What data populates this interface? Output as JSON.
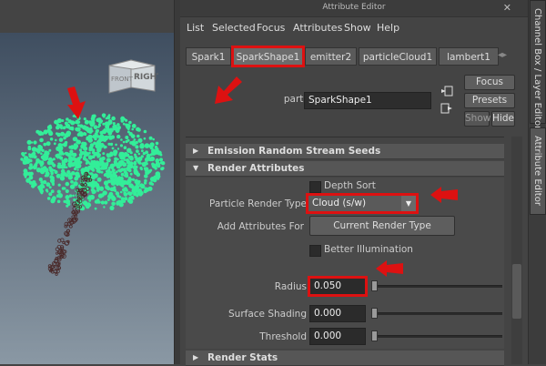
{
  "viewport": {
    "viewcube": {
      "front": "FRONT",
      "right": "RIGHT"
    }
  },
  "window": {
    "title": "Attribute Editor"
  },
  "menu": [
    "List",
    "Selected",
    "Focus",
    "Attributes",
    "Show",
    "Help"
  ],
  "tabs": [
    {
      "label": "Spark1",
      "active": false
    },
    {
      "label": "SparkShape1",
      "active": true
    },
    {
      "label": "emitter2",
      "active": false
    },
    {
      "label": "particleCloud1",
      "active": false
    },
    {
      "label": "lambert1",
      "active": false
    }
  ],
  "node": {
    "type_label": "particle:",
    "name": "SparkShape1"
  },
  "buttons": {
    "focus": "Focus",
    "presets": "Presets",
    "show": "Show",
    "hide": "Hide"
  },
  "sections": {
    "emission": "Emission Random Stream Seeds",
    "render_attributes": "Render Attributes",
    "render_stats": "Render Stats"
  },
  "render": {
    "depth_sort_label": "Depth Sort",
    "render_type_label": "Particle Render Type",
    "render_type_value": "Cloud (s/w)",
    "add_attr_label": "Add Attributes For",
    "add_attr_button": "Current Render Type",
    "better_illum_label": "Better Illumination",
    "radius_label": "Radius",
    "radius_value": "0.050",
    "surface_shading_label": "Surface Shading",
    "surface_shading_value": "0.000",
    "threshold_label": "Threshold",
    "threshold_value": "0.000"
  },
  "side_tabs": {
    "channel_box": "Channel Box / Layer Editor",
    "attribute_editor": "Attribute Editor"
  },
  "colors": {
    "highlight": "#dd1111",
    "particles": "#33ee99"
  }
}
